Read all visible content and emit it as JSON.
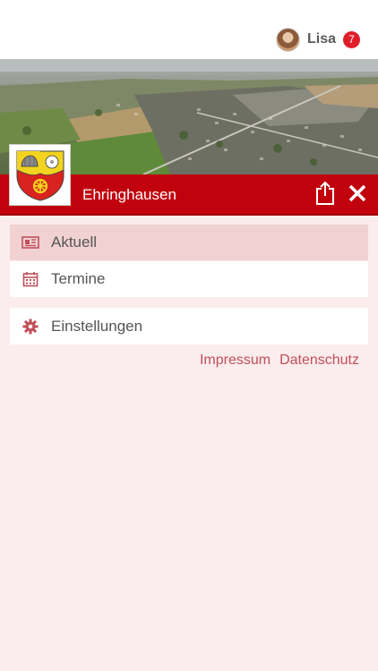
{
  "user": {
    "name": "Lisa",
    "notification_count": "7"
  },
  "header": {
    "title": "Ehringhausen"
  },
  "menu": {
    "items": [
      {
        "label": "Aktuell",
        "icon": "newspaper-icon",
        "active": true
      },
      {
        "label": "Termine",
        "icon": "calendar-icon",
        "active": false
      }
    ],
    "settings": {
      "label": "Einstellungen",
      "icon": "gear-icon"
    }
  },
  "footer": {
    "impressum": "Impressum",
    "datenschutz": "Datenschutz"
  },
  "colors": {
    "brand_red": "#c1010d",
    "background": "#fbeced",
    "active_item": "#f1d1d2",
    "link": "#c0505a",
    "badge": "#e01e2b"
  }
}
